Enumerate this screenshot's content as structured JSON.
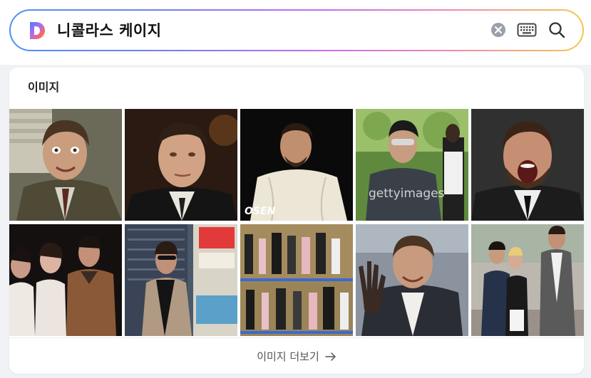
{
  "search": {
    "query": "니콜라스 케이지"
  },
  "images_section": {
    "title": "이미지",
    "more_label": "이미지 더보기",
    "thumbnails": [
      {
        "watermark": ""
      },
      {
        "watermark": ""
      },
      {
        "watermark": "OSEN"
      },
      {
        "watermark": "gettyimages"
      },
      {
        "watermark": ""
      },
      {
        "watermark": ""
      },
      {
        "watermark": ""
      },
      {
        "watermark": ""
      },
      {
        "watermark": ""
      },
      {
        "watermark": ""
      }
    ]
  }
}
